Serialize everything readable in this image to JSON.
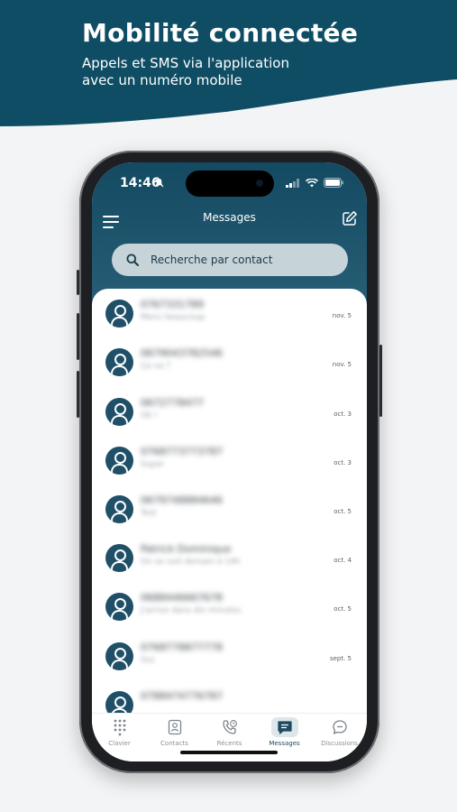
{
  "hero": {
    "title": "Mobilité connectée",
    "subtitle_line1": "Appels et SMS via l'application",
    "subtitle_line2": "avec un numéro mobile",
    "color": "#0e4d63"
  },
  "status_bar": {
    "time": "14:46"
  },
  "header": {
    "title": "Messages",
    "menu_icon": "hamburger-icon",
    "compose_icon": "compose-icon"
  },
  "search": {
    "placeholder": "Recherche par contact"
  },
  "conversations": [
    {
      "name": "0767331789",
      "preview": "Merci beaucoup",
      "date": "nov. 5"
    },
    {
      "name": "0679043782546",
      "preview": "Ça va ?",
      "date": "nov. 5"
    },
    {
      "name": "0672778477",
      "preview": "Ok !",
      "date": "oct. 3"
    },
    {
      "name": "0768773773787",
      "preview": "Super",
      "date": "oct. 3"
    },
    {
      "name": "0679748884646",
      "preview": "Test",
      "date": "oct. 5"
    },
    {
      "name": "Patrick Dominique",
      "preview": "On se voit demain à 14h",
      "date": "oct. 4"
    },
    {
      "name": "0688446667678",
      "preview": "J'arrive dans dix minutes",
      "date": "oct. 5"
    },
    {
      "name": "0768778877778",
      "preview": "Oui",
      "date": "sept. 5"
    },
    {
      "name": "0788474776787",
      "preview": "",
      "date": ""
    }
  ],
  "tabs": [
    {
      "label": "Clavier",
      "icon": "keypad-icon",
      "active": false
    },
    {
      "label": "Contacts",
      "icon": "contacts-icon",
      "active": false
    },
    {
      "label": "Récents",
      "icon": "recent-calls-icon",
      "active": false
    },
    {
      "label": "Messages",
      "icon": "messages-icon",
      "active": true
    },
    {
      "label": "Discussions",
      "icon": "discussions-icon",
      "active": false
    }
  ],
  "colors": {
    "accent": "#134a62",
    "avatar": "#1f5068",
    "search_bg": "#c6d4da"
  }
}
